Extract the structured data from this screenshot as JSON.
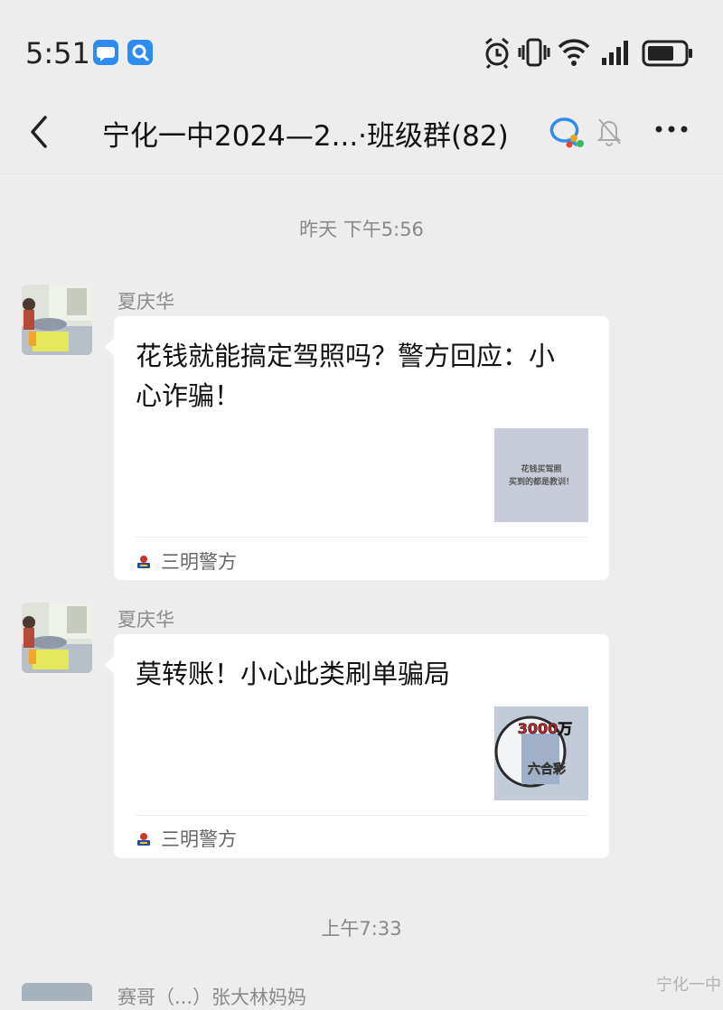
{
  "status_bar": {
    "time": "5:51",
    "notification_icons": [
      "chat-bubble-icon",
      "search-app-icon"
    ],
    "system_icons": [
      "alarm-icon",
      "vibrate-icon",
      "wifi-icon",
      "signal-icon",
      "battery-icon"
    ]
  },
  "header": {
    "title": "宁化一中2024—2...·班级群(82)",
    "back_icon": "chevron-left-icon",
    "collab_icon": "collaboration-icon",
    "mute_icon": "bell-muted-icon",
    "more_icon": "more-dots-icon"
  },
  "timestamps": {
    "first": "昨天 下午5:56",
    "second": "上午7:33"
  },
  "messages": [
    {
      "sender": "夏庆华",
      "title": "花钱就能搞定驾照吗？警方回应：小心诈骗！",
      "thumb_text_1": "花钱买驾照",
      "thumb_text_2": "买到的都是教训！",
      "source": "三明警方"
    },
    {
      "sender": "夏庆华",
      "title": "莫转账！小心此类刷单骗局",
      "thumb_text_1": "3000万",
      "thumb_text_2": "六合彩",
      "source": "三明警方"
    }
  ],
  "partial_next": {
    "sender": "赛哥（...）张大林妈妈"
  },
  "watermark": "宁化一中",
  "colors": {
    "background": "#ededed",
    "card": "#ffffff",
    "accent_blue": "#2e8cf0"
  }
}
